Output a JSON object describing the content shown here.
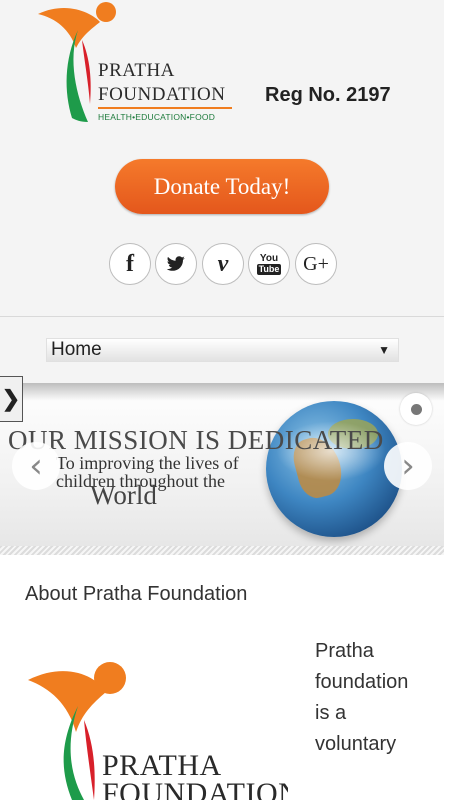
{
  "header": {
    "logo": {
      "line1": "PRATHA",
      "line2": "FOUNDATION",
      "tagline": "HEALTH•EDUCATION•FOOD"
    },
    "reg_no": "Reg No. 2197",
    "donate_label": "Donate Today!",
    "social": [
      {
        "icon": "facebook-icon",
        "glyph": "f"
      },
      {
        "icon": "twitter-icon",
        "glyph": "🐦"
      },
      {
        "icon": "vimeo-icon",
        "glyph": "v"
      },
      {
        "icon": "youtube-icon",
        "glyph_top": "You",
        "glyph_bottom": "Tube"
      },
      {
        "icon": "google-plus-icon",
        "glyph": "G+"
      }
    ]
  },
  "nav": {
    "selected": "Home",
    "arrow": "▼"
  },
  "slider": {
    "side_tab": "❯",
    "heading": "OUR MISSION IS DEDICATED",
    "subline": "To improving the lives of children throughout the",
    "world": "World",
    "prev": "‹",
    "next": "›"
  },
  "about": {
    "title": "About Pratha Foundation",
    "logo": {
      "line1": "PRATHA",
      "line2": "FOUNDATION"
    },
    "body": "Pratha foundation is a voluntary"
  },
  "colors": {
    "accent_orange": "#f07d1f",
    "brand_green": "#1e7b3c",
    "header_bg": "#f4f4f4"
  }
}
